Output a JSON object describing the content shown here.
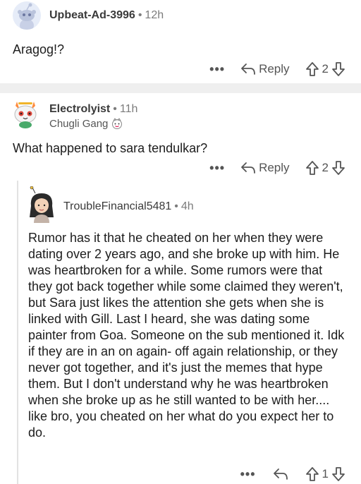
{
  "comments": [
    {
      "username": "Upbeat-Ad-3996",
      "age": "12h",
      "text": "Aragog!?",
      "actions": {
        "more": "•••",
        "reply": "Reply",
        "score": "2"
      }
    },
    {
      "username": "Electrolyist",
      "age": "11h",
      "flair": "Chugli Gang",
      "text": "What happened to sara tendulkar?",
      "actions": {
        "more": "•••",
        "reply": "Reply",
        "score": "2"
      }
    },
    {
      "username": "TroubleFinancial5481",
      "age": "4h",
      "text": "Rumor has it that he cheated on her when they were dating over 2 years ago, and she broke up with him. He was heartbroken for a while. Some rumors were that they got back together while some claimed they weren't, but Sara just likes the attention she gets when she is linked with Gill. Last I heard, she was dating some painter from Goa. Someone on the sub mentioned it. Idk if they are in an on again- off again relationship, or they never got together, and it's just the memes that hype them. But I don't understand why he was heartbroken when she broke up as he still wanted to be with her.... like bro, you cheated on her what do you expect her to do.",
      "actions": {
        "more": "•••",
        "score": "1"
      }
    }
  ],
  "separator": "•",
  "colors": {
    "background": "#ffffff",
    "text": "#1c1c1c",
    "meta": "#7c7c7c",
    "icon": "#555555",
    "divider": "#efefef"
  },
  "icons": [
    "snoo-avatar",
    "cat-avatar",
    "girl-avatar",
    "flair-emoji-icon",
    "reply-arrow-icon",
    "upvote-icon",
    "downvote-icon"
  ]
}
